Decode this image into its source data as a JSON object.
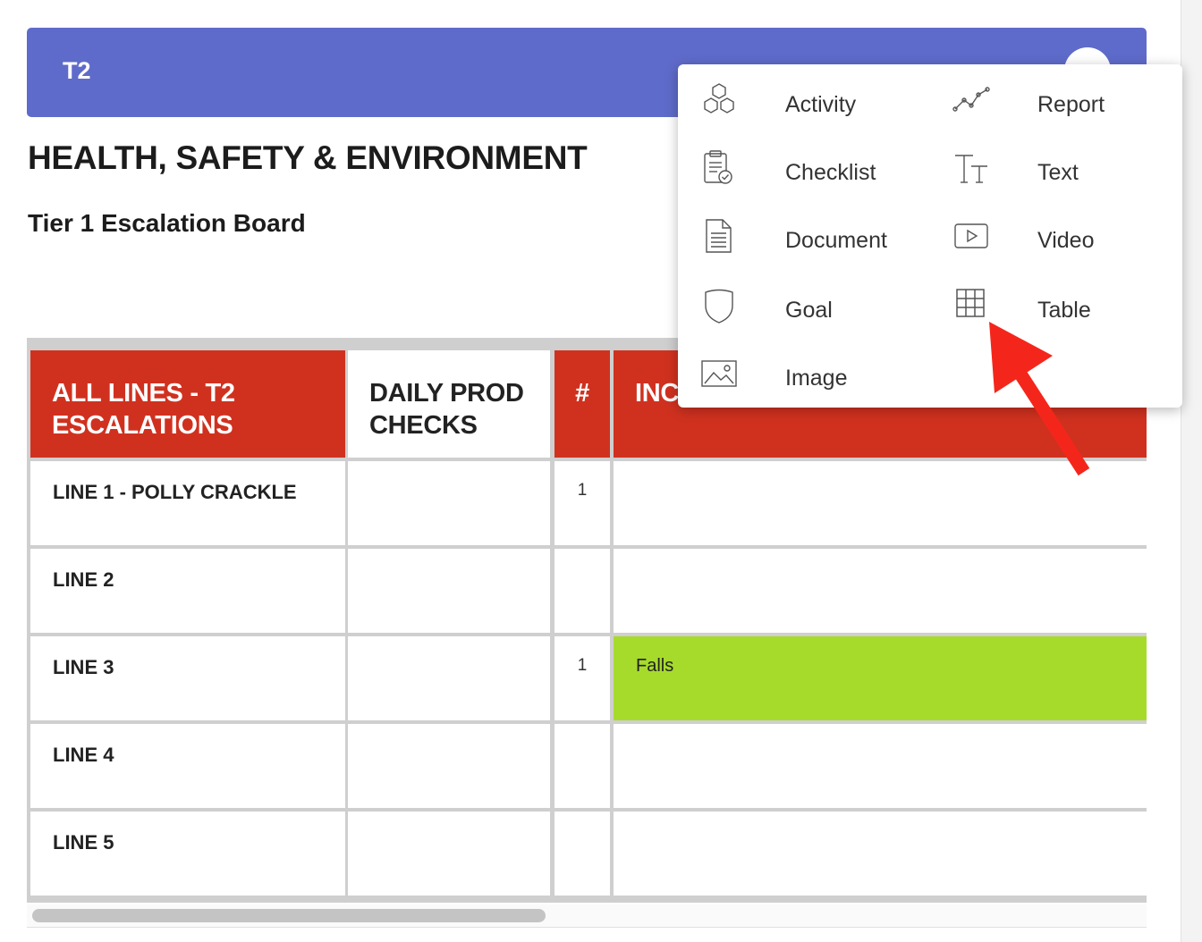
{
  "header": {
    "tab_label": "T2"
  },
  "page": {
    "title": "HEALTH, SAFETY & ENVIRONMENT",
    "subtitle": "Tier 1 Escalation Board"
  },
  "board": {
    "columns": [
      {
        "label": "ALL LINES - T2 ESCALATIONS",
        "color": "#d0311f"
      },
      {
        "label": "DAILY PROD CHECKS",
        "color": "#ffffff"
      },
      {
        "label": "#",
        "color": "#d0311f"
      },
      {
        "label": "INC",
        "color": "#d0311f"
      }
    ],
    "rows": [
      {
        "label": "LINE 1 - POLLY CRACKLE",
        "count": "1",
        "incident": ""
      },
      {
        "label": "LINE 2",
        "count": "",
        "incident": ""
      },
      {
        "label": "LINE 3",
        "count": "1",
        "incident": "Falls",
        "incident_color": "#a6db2c"
      },
      {
        "label": "LINE 4",
        "count": "",
        "incident": ""
      },
      {
        "label": "LINE 5",
        "count": "",
        "incident": ""
      }
    ]
  },
  "add_menu": {
    "items": [
      {
        "label": "Activity",
        "icon": "hexagons-icon"
      },
      {
        "label": "Report",
        "icon": "line-chart-icon"
      },
      {
        "label": "Checklist",
        "icon": "clipboard-check-icon"
      },
      {
        "label": "Text",
        "icon": "text-size-icon"
      },
      {
        "label": "Document",
        "icon": "document-icon"
      },
      {
        "label": "Video",
        "icon": "video-play-icon"
      },
      {
        "label": "Goal",
        "icon": "shield-icon"
      },
      {
        "label": "Table",
        "icon": "table-grid-icon"
      },
      {
        "label": "Image",
        "icon": "image-icon"
      }
    ]
  },
  "colors": {
    "header": "#5f6bca",
    "accent_red": "#d0311f",
    "highlight_green": "#a6db2c",
    "annotation_arrow": "#f4261c"
  }
}
